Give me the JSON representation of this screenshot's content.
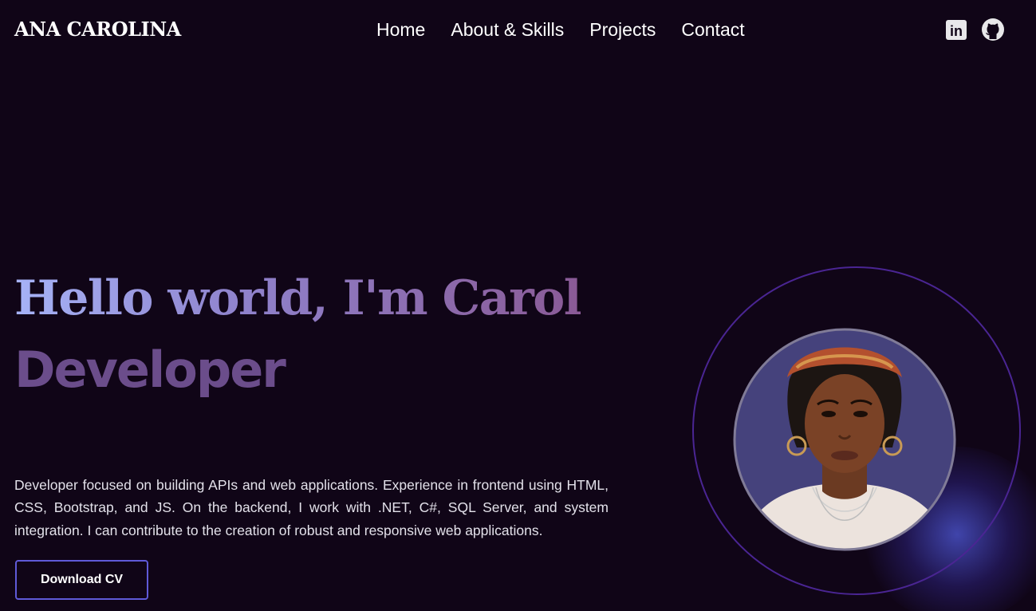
{
  "header": {
    "logo": "ANA CAROLINA",
    "nav": [
      "Home",
      "About & Skills",
      "Projects",
      "Contact"
    ],
    "social": [
      {
        "icon": "linkedin-icon",
        "label": "in"
      },
      {
        "icon": "github-icon"
      }
    ]
  },
  "hero": {
    "greeting": "Hello world, I'm Carol",
    "role": "Developer",
    "description": "Developer focused on building APIs and web applications. Experience in frontend using HTML, CSS, Bootstrap, and JS. On the backend, I work with .NET, C#, SQL Server, and system integration. I can contribute to the creation of robust and responsive web applications.",
    "cta": "Download CV",
    "photo": "profile-portrait"
  },
  "colors": {
    "background": "#100517",
    "accent": "#5f5ad8",
    "ring": "#4a2593",
    "role_text": "#6b4d8b"
  }
}
